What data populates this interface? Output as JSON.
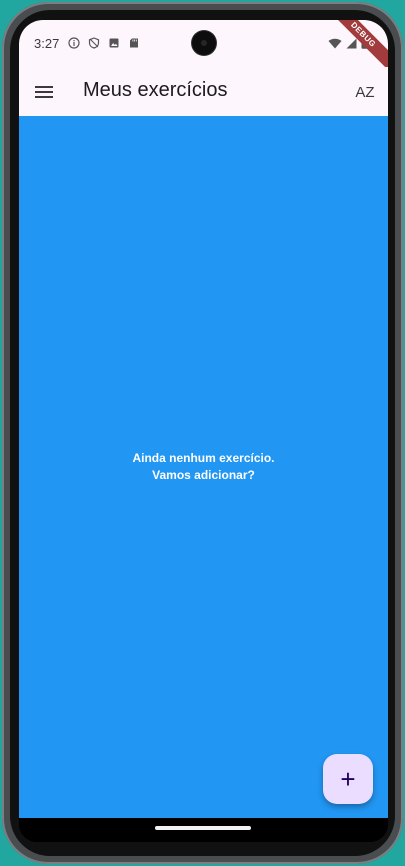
{
  "status_bar": {
    "time": "3:27",
    "icons_left": [
      "info-icon",
      "shield-icon",
      "photo-icon",
      "sd-card-icon"
    ],
    "icons_right": [
      "wifi-icon",
      "signal-icon",
      "battery-icon"
    ],
    "debug_label": "DEBUG"
  },
  "app_bar": {
    "title": "Meus exercícios",
    "menu_icon": "menu-icon",
    "sort_icon": "sort-az-icon",
    "sort_label": "AZ"
  },
  "body": {
    "background": "#2196f3",
    "empty_line1": "Ainda nenhum exercício.",
    "empty_line2": "Vamos adicionar?"
  },
  "fab": {
    "icon": "plus-icon",
    "label": "+"
  },
  "colors": {
    "app_bar_bg": "#fdf6fd",
    "fab_bg": "#eaddff",
    "debug_banner": "#a23b3b"
  }
}
